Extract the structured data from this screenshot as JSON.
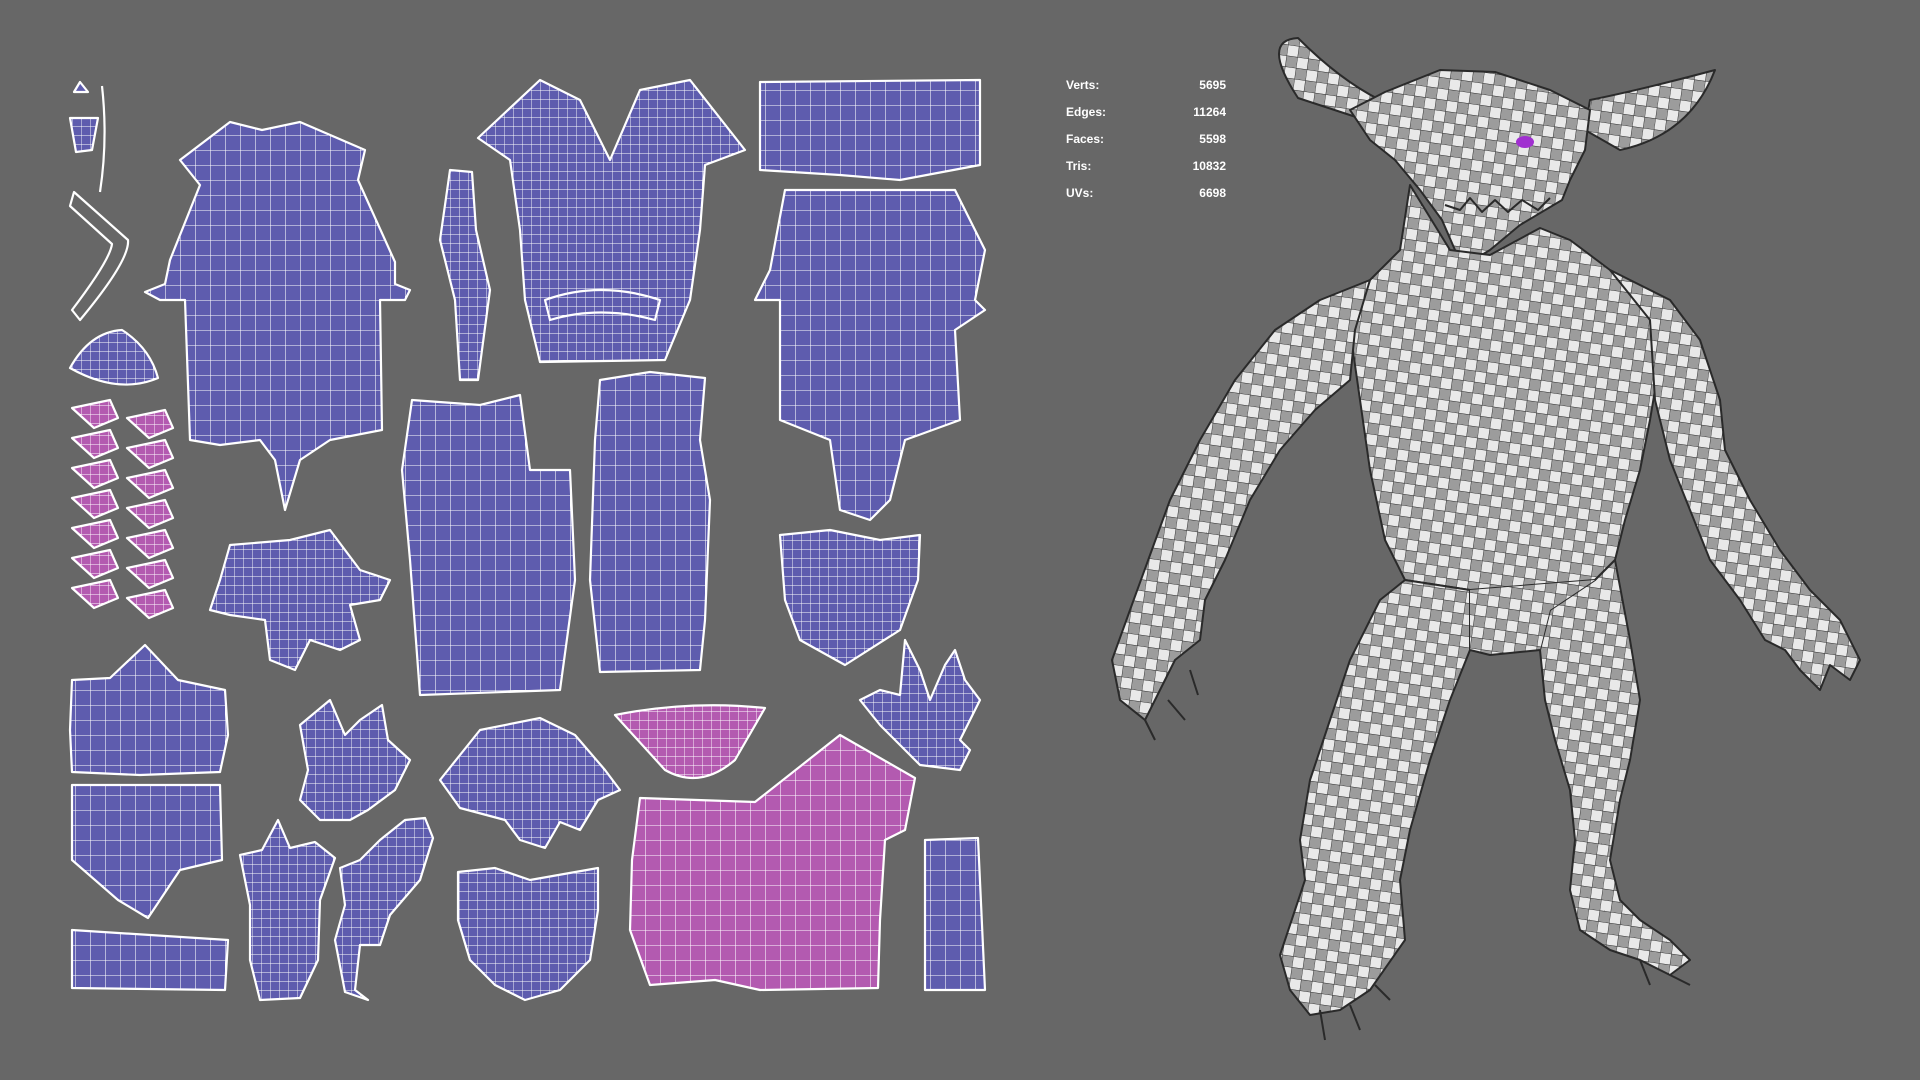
{
  "stats": [
    {
      "label": "Verts:",
      "value": "5695"
    },
    {
      "label": "Edges:",
      "value": "11264"
    },
    {
      "label": "Faces:",
      "value": "5598"
    },
    {
      "label": "Tris:",
      "value": "10832"
    },
    {
      "label": "UVs:",
      "value": "6698"
    }
  ],
  "colors": {
    "background": "#676767",
    "uv_shell": "#5e5cae",
    "uv_shell_highlight": "#b35ab0",
    "uv_wire": "#ffffff",
    "checker_light": "#e9e9e9",
    "checker_dark": "#9c9c9c",
    "eye_glow": "#a030d0"
  }
}
